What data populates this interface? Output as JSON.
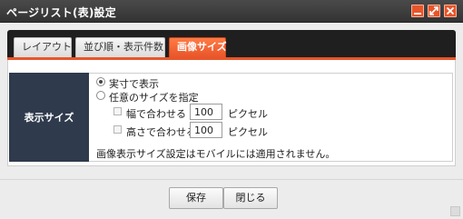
{
  "window": {
    "title": "ページリスト(表)設定",
    "accent_color": "#e8552a",
    "titlebar_color": "#3c3c3c"
  },
  "tabs": [
    {
      "label": "レイアウト",
      "active": false
    },
    {
      "label": "並び順・表示件数",
      "active": false
    },
    {
      "label": "画像サイズ",
      "active": true
    }
  ],
  "settings": {
    "row_label": "表示サイズ",
    "options": {
      "actual_size": "実寸で表示",
      "custom_size": "任意のサイズを指定",
      "fit_width": "幅で合わせる",
      "fit_height": "高さで合わせる"
    },
    "selected_option": "actual_size",
    "width_value": "100",
    "height_value": "100",
    "unit": "ピクセル",
    "note": "画像表示サイズ設定はモバイルには適用されません。"
  },
  "buttons": {
    "save": "保存",
    "close": "閉じる"
  }
}
